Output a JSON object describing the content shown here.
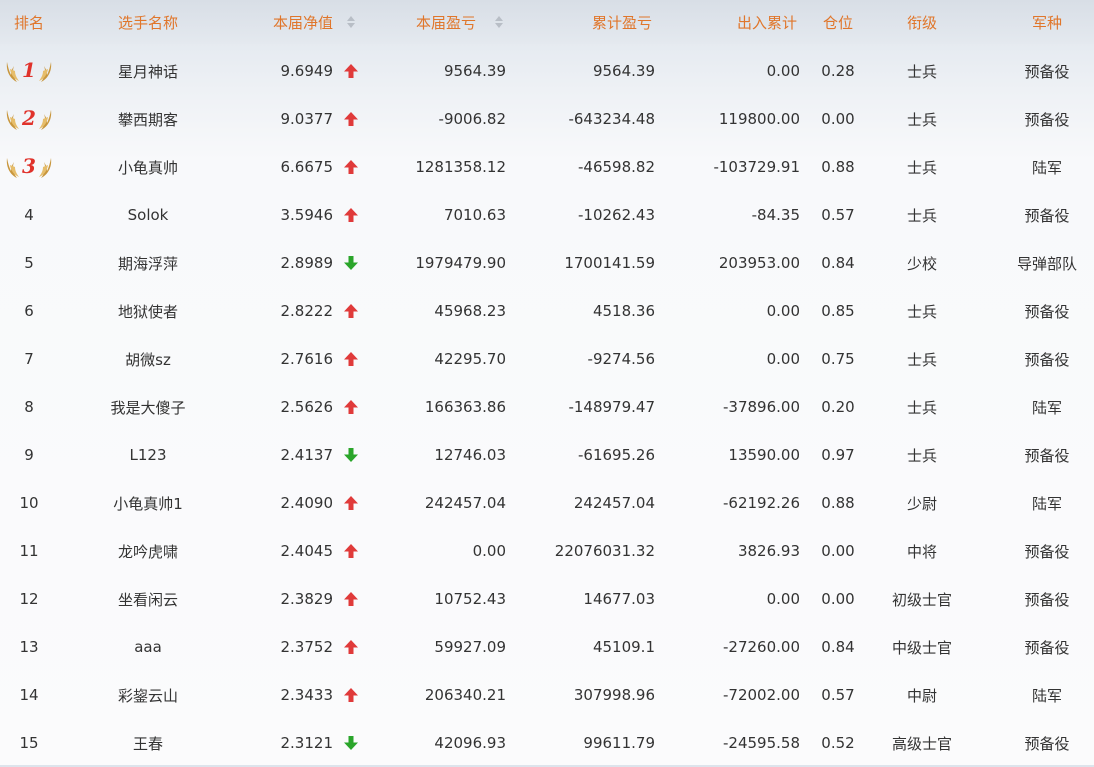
{
  "table": {
    "headers": {
      "rank": "排名",
      "name": "选手名称",
      "nav": "本届净值",
      "pnl": "本届盈亏",
      "cum_pnl": "累计盈亏",
      "flow": "出入累计",
      "position": "仓位",
      "mil_rank": "衔级",
      "branch": "军种"
    },
    "medal_icon": "laurel-wings-icon",
    "arrow_icons": {
      "up": "arrow-up-icon",
      "down": "arrow-down-icon"
    },
    "colors": {
      "header_text": "#e0762b",
      "up": "#e03a3a",
      "down": "#2aa52a",
      "medal_num": "#e0322b",
      "wing": "#c8963c"
    },
    "rows": [
      {
        "rank": "1",
        "name": "星月神话",
        "nav": "9.6949",
        "trend": "up",
        "pnl": "9564.39",
        "cum_pnl": "9564.39",
        "flow": "0.00",
        "position": "0.28",
        "mil_rank": "士兵",
        "branch": "预备役"
      },
      {
        "rank": "2",
        "name": "攀西期客",
        "nav": "9.0377",
        "trend": "up",
        "pnl": "-9006.82",
        "cum_pnl": "-643234.48",
        "flow": "119800.00",
        "position": "0.00",
        "mil_rank": "士兵",
        "branch": "预备役"
      },
      {
        "rank": "3",
        "name": "小龟真帅",
        "nav": "6.6675",
        "trend": "up",
        "pnl": "1281358.12",
        "cum_pnl": "-46598.82",
        "flow": "-103729.91",
        "position": "0.88",
        "mil_rank": "士兵",
        "branch": "陆军"
      },
      {
        "rank": "4",
        "name": "Solok",
        "nav": "3.5946",
        "trend": "up",
        "pnl": "7010.63",
        "cum_pnl": "-10262.43",
        "flow": "-84.35",
        "position": "0.57",
        "mil_rank": "士兵",
        "branch": "预备役"
      },
      {
        "rank": "5",
        "name": "期海浮萍",
        "nav": "2.8989",
        "trend": "down",
        "pnl": "1979479.90",
        "cum_pnl": "1700141.59",
        "flow": "203953.00",
        "position": "0.84",
        "mil_rank": "少校",
        "branch": "导弹部队"
      },
      {
        "rank": "6",
        "name": "地狱使者",
        "nav": "2.8222",
        "trend": "up",
        "pnl": "45968.23",
        "cum_pnl": "4518.36",
        "flow": "0.00",
        "position": "0.85",
        "mil_rank": "士兵",
        "branch": "预备役"
      },
      {
        "rank": "7",
        "name": "胡微sz",
        "nav": "2.7616",
        "trend": "up",
        "pnl": "42295.70",
        "cum_pnl": "-9274.56",
        "flow": "0.00",
        "position": "0.75",
        "mil_rank": "士兵",
        "branch": "预备役"
      },
      {
        "rank": "8",
        "name": "我是大傻子",
        "nav": "2.5626",
        "trend": "up",
        "pnl": "166363.86",
        "cum_pnl": "-148979.47",
        "flow": "-37896.00",
        "position": "0.20",
        "mil_rank": "士兵",
        "branch": "陆军"
      },
      {
        "rank": "9",
        "name": "L123",
        "nav": "2.4137",
        "trend": "down",
        "pnl": "12746.03",
        "cum_pnl": "-61695.26",
        "flow": "13590.00",
        "position": "0.97",
        "mil_rank": "士兵",
        "branch": "预备役"
      },
      {
        "rank": "10",
        "name": "小龟真帅1",
        "nav": "2.4090",
        "trend": "up",
        "pnl": "242457.04",
        "cum_pnl": "242457.04",
        "flow": "-62192.26",
        "position": "0.88",
        "mil_rank": "少尉",
        "branch": "陆军"
      },
      {
        "rank": "11",
        "name": "龙吟虎啸",
        "nav": "2.4045",
        "trend": "up",
        "pnl": "0.00",
        "cum_pnl": "22076031.32",
        "flow": "3826.93",
        "position": "0.00",
        "mil_rank": "中将",
        "branch": "预备役"
      },
      {
        "rank": "12",
        "name": "坐看闲云",
        "nav": "2.3829",
        "trend": "up",
        "pnl": "10752.43",
        "cum_pnl": "14677.03",
        "flow": "0.00",
        "position": "0.00",
        "mil_rank": "初级士官",
        "branch": "预备役"
      },
      {
        "rank": "13",
        "name": "aaa",
        "nav": "2.3752",
        "trend": "up",
        "pnl": "59927.09",
        "cum_pnl": "45109.1",
        "flow": "-27260.00",
        "position": "0.84",
        "mil_rank": "中级士官",
        "branch": "预备役"
      },
      {
        "rank": "14",
        "name": "彩鋆云山",
        "nav": "2.3433",
        "trend": "up",
        "pnl": "206340.21",
        "cum_pnl": "307998.96",
        "flow": "-72002.00",
        "position": "0.57",
        "mil_rank": "中尉",
        "branch": "陆军"
      },
      {
        "rank": "15",
        "name": "王春",
        "nav": "2.3121",
        "trend": "down",
        "pnl": "42096.93",
        "cum_pnl": "99611.79",
        "flow": "-24595.58",
        "position": "0.52",
        "mil_rank": "高级士官",
        "branch": "预备役"
      }
    ]
  }
}
